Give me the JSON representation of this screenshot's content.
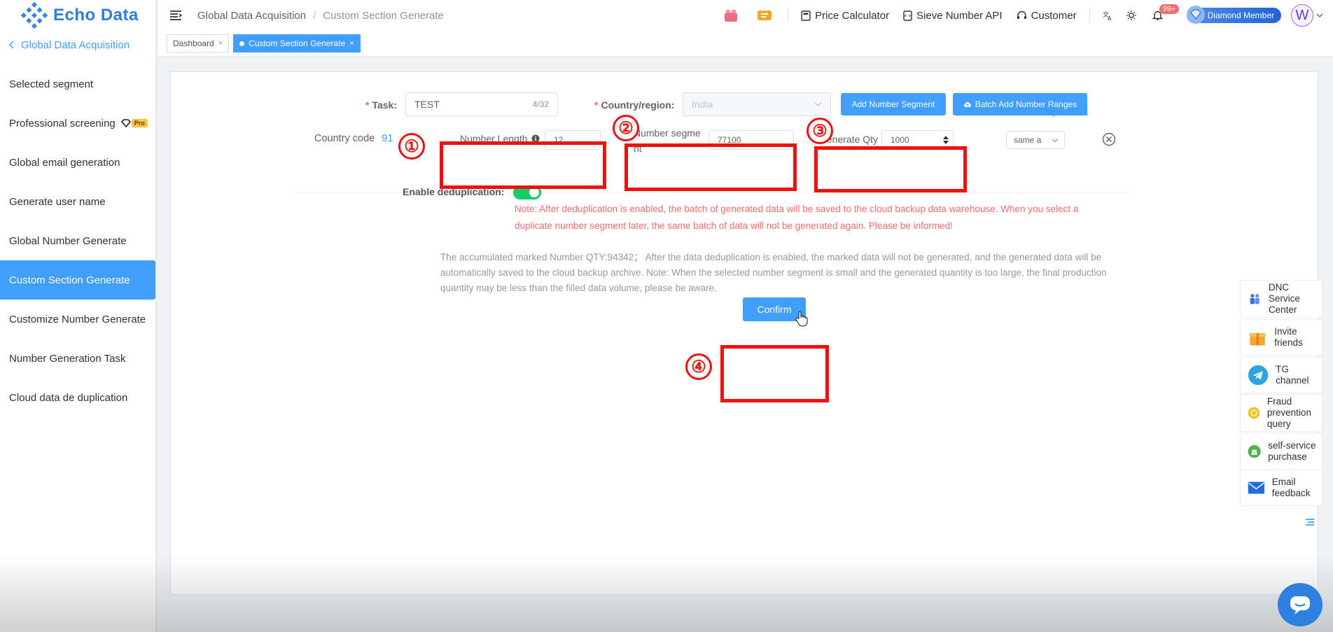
{
  "brand": {
    "name": "Echo Data"
  },
  "sidebar": {
    "back_label": "Global Data Acquisition",
    "items": [
      {
        "label": "Selected segment"
      },
      {
        "label": "Professional screening",
        "badge": "Pro"
      },
      {
        "label": "Global email generation"
      },
      {
        "label": "Generate user name"
      },
      {
        "label": "Global Number Generate"
      },
      {
        "label": "Custom Section Generate",
        "active": true
      },
      {
        "label": "Customize Number Generate"
      },
      {
        "label": "Number Generation Task"
      },
      {
        "label": "Cloud data de duplication"
      }
    ]
  },
  "header": {
    "breadcrumb": [
      "Global Data Acquisition",
      "Custom Section Generate"
    ],
    "links": {
      "price": "Price Calculator",
      "sieve": "Sieve Number API",
      "customer": "Customer"
    },
    "notification_count": "99+",
    "member_label": "Diamond Member",
    "avatar_letter": "W"
  },
  "tabs": [
    {
      "label": "Dashboard",
      "active": false
    },
    {
      "label": "Custom Section Generate",
      "active": true
    }
  ],
  "form": {
    "task_label": "Task:",
    "task_value": "TEST",
    "task_count": "4/32",
    "country_label": "Country/region:",
    "country_value": "India",
    "add_segment_btn": "Add Number Segment",
    "batch_add_btn": "Batch Add Number Ranges",
    "sync_count_link": "Generation sync count",
    "country_code_label": "Country code",
    "country_code_value": "91",
    "number_length_label": "Number Length",
    "number_length_value": "12",
    "number_segment_label_1": "Number segme",
    "number_segment_label_2": "nt",
    "number_segment_value": "77100",
    "generate_qty_label": "Generate Qty",
    "generate_qty_value": "1000",
    "sync_select_value": "same a",
    "dedup_label": "Enable deduplication:",
    "dedup_note_1": "Note: After deduplication is enabled, the batch of generated data will be saved to the cloud backup data warehouse. When you select a",
    "dedup_note_2": "duplicate number segment later, the same batch of data will not be generated again. Please be informed!",
    "info_1": "The accumulated marked Number QTY:94342；  After the data deduplication is enabled, the marked data will not be generated, and the generated data will be",
    "info_2": "automatically saved to the cloud backup archive. Note: When the selected number segment is small and the generated quantity is too large, the final production",
    "info_3": "quantity may be less than the filled data volume, please be aware.",
    "confirm_btn": "Confirm"
  },
  "annotations": [
    "①",
    "②",
    "③",
    "④"
  ],
  "float_panel": [
    {
      "label": "DNC Service Center",
      "icon": "people-icon"
    },
    {
      "label": "Invite friends",
      "icon": "gift-icon"
    },
    {
      "label": "TG channel",
      "icon": "telegram-icon"
    },
    {
      "label": "Fraud prevention query",
      "icon": "coin-icon"
    },
    {
      "label": "self-service purchase",
      "icon": "money-bag-icon"
    },
    {
      "label": "Email feedback",
      "icon": "mail-icon"
    }
  ],
  "colors": {
    "primary": "#409eff",
    "annotation": "#ef1010",
    "switch_on": "#13ce66",
    "warning_text": "#f56c6c"
  }
}
